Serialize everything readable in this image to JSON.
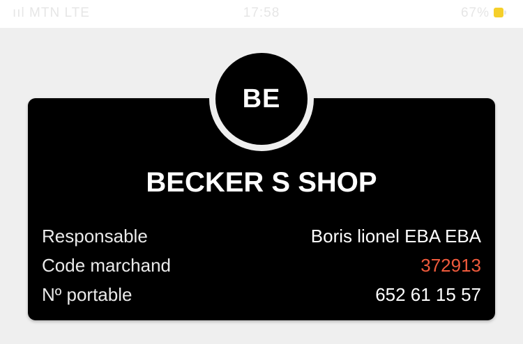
{
  "status_bar": {
    "carrier": "ııl MTN  LTE",
    "time": "17:58",
    "battery_percent": "67%",
    "battery_color": "#f5cf2a"
  },
  "merchant": {
    "initials": "BE",
    "name": "BECKER S SHOP",
    "fields": [
      {
        "label": "Responsable",
        "value": "Boris lionel EBA EBA"
      },
      {
        "label": "Code marchand",
        "value": "372913"
      },
      {
        "label": "Nº portable",
        "value": "652 61 15 57"
      }
    ]
  },
  "colors": {
    "card_background": "#000000",
    "page_background": "#efefef",
    "code_accent": "#ef5a3c"
  }
}
